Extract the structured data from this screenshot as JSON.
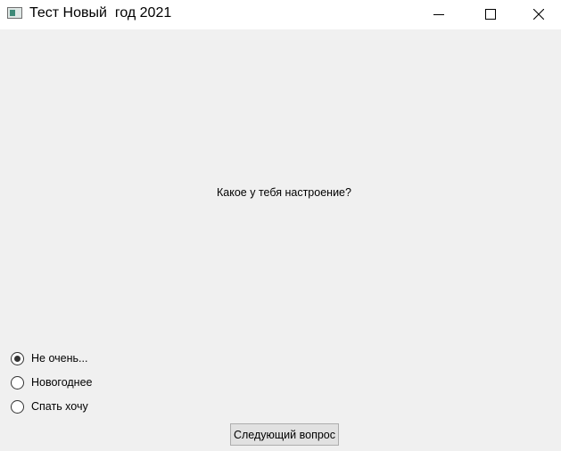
{
  "window": {
    "title": "Тест Новый  год 2021",
    "icon": "app-window-icon",
    "controls": [
      "minimize-icon",
      "maximize-icon",
      "close-icon"
    ]
  },
  "main": {
    "question": "Какое у тебя настроение?",
    "options": [
      {
        "label": "Не очень...",
        "selected": true
      },
      {
        "label": "Новогоднее",
        "selected": false
      },
      {
        "label": "Спать хочу",
        "selected": false
      }
    ],
    "next_button_label": "Следующий вопрос"
  },
  "colors": {
    "titlebar_bg": "#ffffff",
    "window_bg": "#f0f0f0",
    "button_bg": "#e1e1e1",
    "button_border": "#adadad"
  }
}
